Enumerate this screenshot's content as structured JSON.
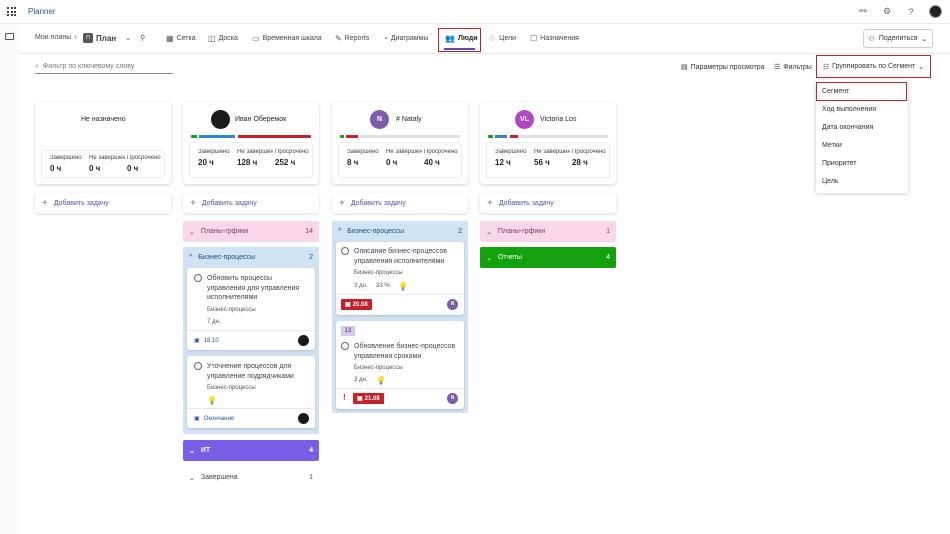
{
  "app": {
    "name": "Planner"
  },
  "nav": {
    "breadcrumb": "Мои планы",
    "plan": "План",
    "plan_badge": "П",
    "tabs": [
      "Сетка",
      "Доска",
      "Временная шкала",
      "Reports",
      "Диаграммы",
      "Люди",
      "Цели",
      "Назначения"
    ],
    "share": "Поделиться"
  },
  "toolbar": {
    "filter_placeholder": "Фильтр по ключевому слову",
    "view_params": "Параметры просмотра",
    "filters": "Фильтры",
    "group_by": "Группировать по Сегмент"
  },
  "dropdown": [
    "Сегмент",
    "Ход выполнения",
    "Дата окончания",
    "Метки",
    "Приоритет",
    "Цель"
  ],
  "stat_labels": [
    "Завершено",
    "Не завершено",
    "Просрочено"
  ],
  "add_task": "Добавить задачу",
  "columns": [
    {
      "name": "Не назначено",
      "stats": [
        "0 ч",
        "0 ч",
        "0 ч"
      ]
    },
    {
      "name": "Иван Оберемок",
      "stats": [
        "20 ч",
        "128 ч",
        "252 ч"
      ]
    },
    {
      "name": "# Nataly",
      "initial": "N",
      "stats": [
        "8 ч",
        "0 ч",
        "40 ч"
      ]
    },
    {
      "name": "Victoria Los",
      "initial": "VL",
      "stats": [
        "12 ч",
        "56 ч",
        "28 ч"
      ]
    }
  ],
  "buckets": {
    "plany_name": "Планы-грфики",
    "plany_count_ivan": "14",
    "plany_count_vl": "1",
    "biz_name": "Бизнес-процессы",
    "biz_count_ivan": "2",
    "biz_count_nataly": "2",
    "it_name": "ИТ",
    "it_count": "4",
    "reports_name": "Отчеты",
    "reports_count": "4",
    "done_name": "Завершена",
    "done_count": "1"
  },
  "tasks": {
    "t1": {
      "title": "Обновить процессы управления для управления исполнителями",
      "bucket": "Бизнес-процессы",
      "dur": "7 дн.",
      "date": "18.10"
    },
    "t2": {
      "title": "Уточнение процессов для управление подрядчиками",
      "bucket": "Бизнес-процессы",
      "date": "Окончание"
    },
    "t3": {
      "title": "Описание бизнес-процессов управления исполнителями",
      "bucket": "Бизнес-процессы",
      "dur": "3 дн.",
      "pct": "33 %",
      "date": "20.08",
      "initial": "N"
    },
    "t4": {
      "label": "13",
      "title": "Обновление бизнес-процессов управления сроками",
      "bucket": "Бизнес-процессы",
      "dur": "3 дн.",
      "date": "21.08",
      "initial": "N"
    }
  },
  "colors": {
    "accent": "#4f52b2",
    "red": "#c4212b",
    "pink": "#f8d7e8",
    "blue": "#cfe3f4",
    "purple": "#7b5ee8",
    "green": "#13a10e"
  }
}
